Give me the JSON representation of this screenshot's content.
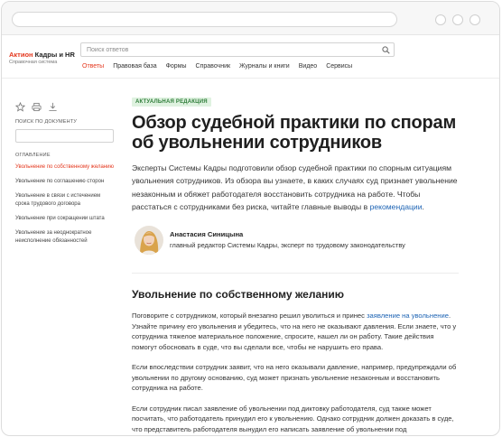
{
  "header": {
    "logo_brand": "Актион",
    "logo_title": "Кадры и HR",
    "logo_sub": "Справочная система",
    "search_placeholder": "Поиск ответов",
    "nav": [
      "Ответы",
      "Правовая база",
      "Формы",
      "Справочник",
      "Журналы и книги",
      "Видео",
      "Сервисы"
    ]
  },
  "sidebar": {
    "search_label": "ПОИСК ПО ДОКУМЕНТУ",
    "toc_label": "ОГЛАВЛЕНИЕ",
    "toc": [
      "Увольнение по собственному желанию",
      "Увольнение по соглашению сторон",
      "Увольнение в связи с истечением срока трудового договора",
      "Увольнение при сокращении штата",
      "Увольнение за неоднократное неисполнение обязанностей"
    ]
  },
  "article": {
    "badge": "АКТУАЛЬНАЯ РЕДАКЦИЯ",
    "title": "Обзор судебной практики по спорам об увольнении сотрудников",
    "lead": "Эксперты Системы Кадры подготовили обзор судебной практики по спорным ситуациям увольнения сотрудников. Из обзора вы узнаете, в каких случаях суд признает увольнение незаконным и обяжет работодателя восстановить сотрудника на работе. Чтобы расстаться с сотрудниками без риска, читайте главные выводы в ",
    "lead_link": "рекомендации",
    "lead_end": ".",
    "author_name": "Анастасия Синицына",
    "author_role": "главный редактор Системы Кадры, эксперт по трудовому законодательству",
    "section_title": "Увольнение по собственному желанию",
    "p1_start": "Поговорите с сотрудником, который внезапно решил уволиться и принес ",
    "p1_link": "заявление на увольнение",
    "p1_end": ". Узнайте причину его увольнения и убедитесь, что на него не оказывают давления. Если знаете, что у сотрудника тяжелое материальное положение, спросите, нашел ли он работу. Такие действия помогут обосновать в суде, что вы сделали все, чтобы не нарушить его права.",
    "p2": "Если впоследствии сотрудник заявит, что на него оказывали давление, например, предупреждали об увольнении по другому основанию, суд может признать увольнение незаконным и восстановить сотрудника на работе.",
    "p3": "Если сотрудник писал заявление об увольнении под диктовку работодателя, суд также может посчитать, что работодатель принудил его к увольнению. Однако сотрудник должен доказать в суде, что представитель работодателя вынудил его написать заявление об увольнении под"
  },
  "colors": {
    "accent": "#e4371d",
    "link": "#1e64b4",
    "badge_bg": "#dff2e0",
    "badge_text": "#2f7d3a"
  }
}
